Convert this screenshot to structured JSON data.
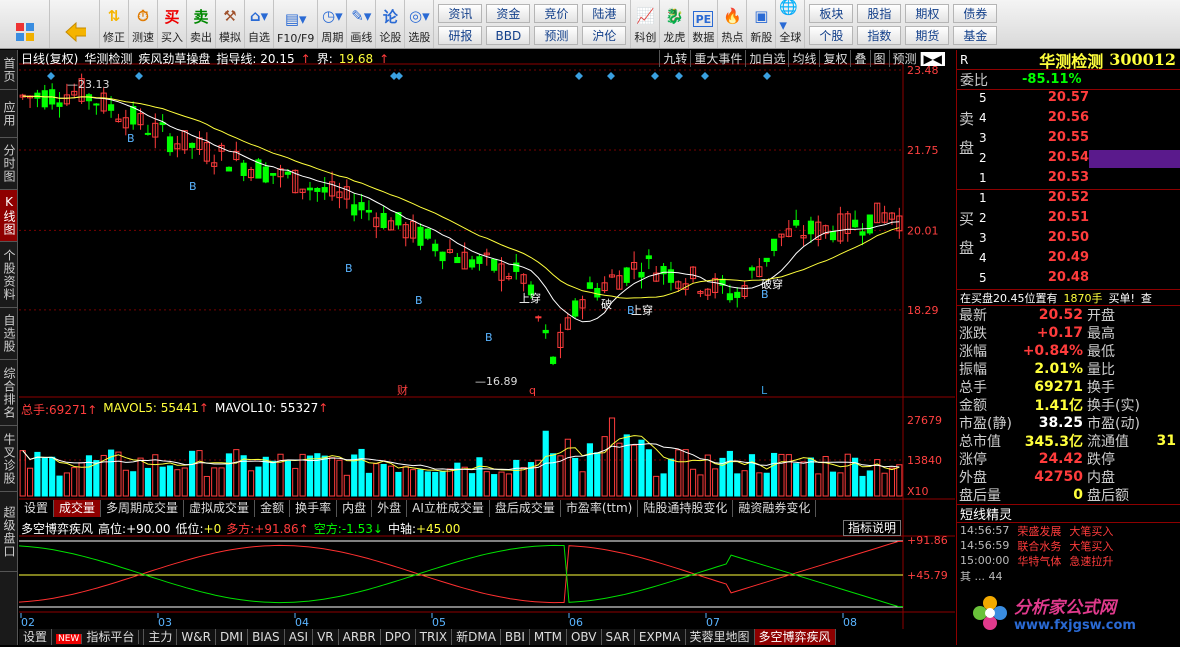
{
  "toolbar": {
    "buttons": [
      {
        "label": "",
        "icon": "window-icon"
      },
      {
        "label": "",
        "icon": "back-arrow-icon"
      },
      {
        "label": "修正",
        "icon": "up-down-arrow-icon"
      },
      {
        "label": "测速",
        "icon": "clock-icon"
      },
      {
        "label": "买入",
        "icon": "买"
      },
      {
        "label": "卖出",
        "icon": "卖"
      },
      {
        "label": "模拟",
        "icon": "hammer-icon"
      },
      {
        "label": "自选",
        "icon": "home-icon"
      },
      {
        "label": "F10/F9",
        "icon": "doc-icon"
      },
      {
        "label": "周期",
        "icon": "cycle-icon"
      },
      {
        "label": "画线",
        "icon": "pencil-icon"
      },
      {
        "label": "论股",
        "icon": "论"
      },
      {
        "label": "选股",
        "icon": "chart-search-icon"
      }
    ],
    "grid1": [
      "资讯",
      "资金",
      "竞价",
      "陆港",
      "研报",
      "BBD",
      "预测",
      "沪伦"
    ],
    "buttons2": [
      {
        "label": "科创",
        "icon": "kc-chart-icon"
      },
      {
        "label": "龙虎",
        "icon": "dragon-icon"
      },
      {
        "label": "数据",
        "icon": "PE"
      },
      {
        "label": "热点",
        "icon": "fire-icon"
      },
      {
        "label": "新股",
        "icon": "ipo-icon"
      },
      {
        "label": "全球",
        "icon": "globe-icon"
      }
    ],
    "grid2": [
      "板块",
      "股指",
      "期权",
      "债券",
      "个股",
      "指数",
      "期货",
      "基金"
    ]
  },
  "sidebar": [
    "首页",
    "应用",
    "分时图",
    "K线图",
    "个股资料",
    "自选股",
    "综合排名",
    "牛叉诊股",
    "超级盘口"
  ],
  "chart": {
    "period": "日线(复权)",
    "stock": "华测检测",
    "indicator": "疾风劲草操盘",
    "guide_label": "指导线:",
    "guide_value": "20.15",
    "bound_label": "界:",
    "bound_value": "19.68",
    "tools": [
      "九转",
      "重大事件",
      "加自选",
      "均线",
      "复权",
      "叠",
      "图",
      "预测"
    ],
    "y_labels": [
      "23.48",
      "21.75",
      "20.01",
      "18.29"
    ],
    "high_label": "23.13",
    "low_label": "16.89",
    "annotations": [
      "上穿",
      "上穿",
      "破",
      "破穿"
    ],
    "markers": [
      "财",
      "q",
      "L"
    ],
    "b_label": "B",
    "vol_label": "总手:",
    "vol_value": "69271",
    "mavol5_label": "MAVOL5:",
    "mavol5_value": "55441",
    "mavol10_label": "MAVOL10:",
    "mavol10_value": "55327",
    "vol_axis": [
      "27679",
      "13840",
      "X10"
    ],
    "ind_tabs": [
      "设置",
      "成交量",
      "多周期成交量",
      "虚拟成交量",
      "金额",
      "换手率",
      "内盘",
      "外盘",
      "AI立桩成交量",
      "盘后成交量",
      "市盈率(ttm)",
      "陆股通持股变化",
      "融资融券变化"
    ],
    "osc_name": "多空博弈疾风",
    "osc_high_label": "高位:",
    "osc_high": "+90.00",
    "osc_low_label": "低位:",
    "osc_low": "+0",
    "osc_duo_label": "多方:",
    "osc_duo": "+91.86",
    "osc_kong_label": "空方:",
    "osc_kong": "-1.53",
    "osc_mid_label": "中轴:",
    "osc_mid": "+45.00",
    "osc_help": "指标说明",
    "osc_axis": [
      "+91.86",
      "+45.79"
    ],
    "months": [
      "02",
      "03",
      "04",
      "05",
      "06",
      "07",
      "08"
    ],
    "bottom_tabs": [
      "设置",
      "指标平台",
      "主力",
      "W&R",
      "DMI",
      "BIAS",
      "ASI",
      "VR",
      "ARBR",
      "DPO",
      "TRIX",
      "新DMA",
      "BBI",
      "MTM",
      "OBV",
      "SAR",
      "EXPMA",
      "芙蓉里地图",
      "多空博弈疾风"
    ],
    "new_badge": "NEW"
  },
  "right": {
    "r": "R",
    "name": "华测检测",
    "code": "300012",
    "weibi_label": "委比",
    "weibi": "-85.11%",
    "sell_label": "卖盘",
    "buy_label": "买盘",
    "sell": [
      [
        "5",
        "20.57"
      ],
      [
        "4",
        "20.56"
      ],
      [
        "3",
        "20.55"
      ],
      [
        "2",
        "20.54"
      ],
      [
        "1",
        "20.53"
      ]
    ],
    "buy": [
      [
        "1",
        "20.52"
      ],
      [
        "2",
        "20.51"
      ],
      [
        "3",
        "20.50"
      ],
      [
        "4",
        "20.49"
      ],
      [
        "5",
        "20.48"
      ]
    ],
    "msg": [
      "在买盘20.45位置有",
      "1870手",
      "买单!",
      "查"
    ],
    "quote": [
      [
        "最新",
        "20.52",
        "开盘",
        ""
      ],
      [
        "涨跌",
        "+0.17",
        "最高",
        ""
      ],
      [
        "涨幅",
        "+0.84%",
        "最低",
        ""
      ],
      [
        "振幅",
        "2.01%",
        "量比",
        ""
      ],
      [
        "总手",
        "69271",
        "换手",
        ""
      ],
      [
        "金额",
        "1.41亿",
        "换手(实)",
        ""
      ],
      [
        "市盈(静)",
        "38.25",
        "市盈(动)",
        ""
      ],
      [
        "总市值",
        "345.3亿",
        "流通值",
        "31"
      ],
      [
        "涨停",
        "24.42",
        "跌停",
        ""
      ],
      [
        "外盘",
        "42750",
        "内盘",
        ""
      ],
      [
        "盘后量",
        "0",
        "盘后额",
        ""
      ]
    ],
    "sprite_title": "短线精灵",
    "sprites": [
      [
        "14:56:57",
        "荣盛发展",
        "大笔买入"
      ],
      [
        "14:56:59",
        "联合水务",
        "大笔买入"
      ],
      [
        "15:00:00",
        "华特气体",
        "急速拉升"
      ]
    ],
    "sprite_partial": "其 ... 44"
  },
  "logo": {
    "text": "分析家公式网",
    "url": "www.fxjgsw.com"
  },
  "colors": {
    "up": "#ff3c3c",
    "down": "#00ff00",
    "accent": "#8e0000",
    "ma1": "#ffffff",
    "ma2": "#ffff3c"
  }
}
